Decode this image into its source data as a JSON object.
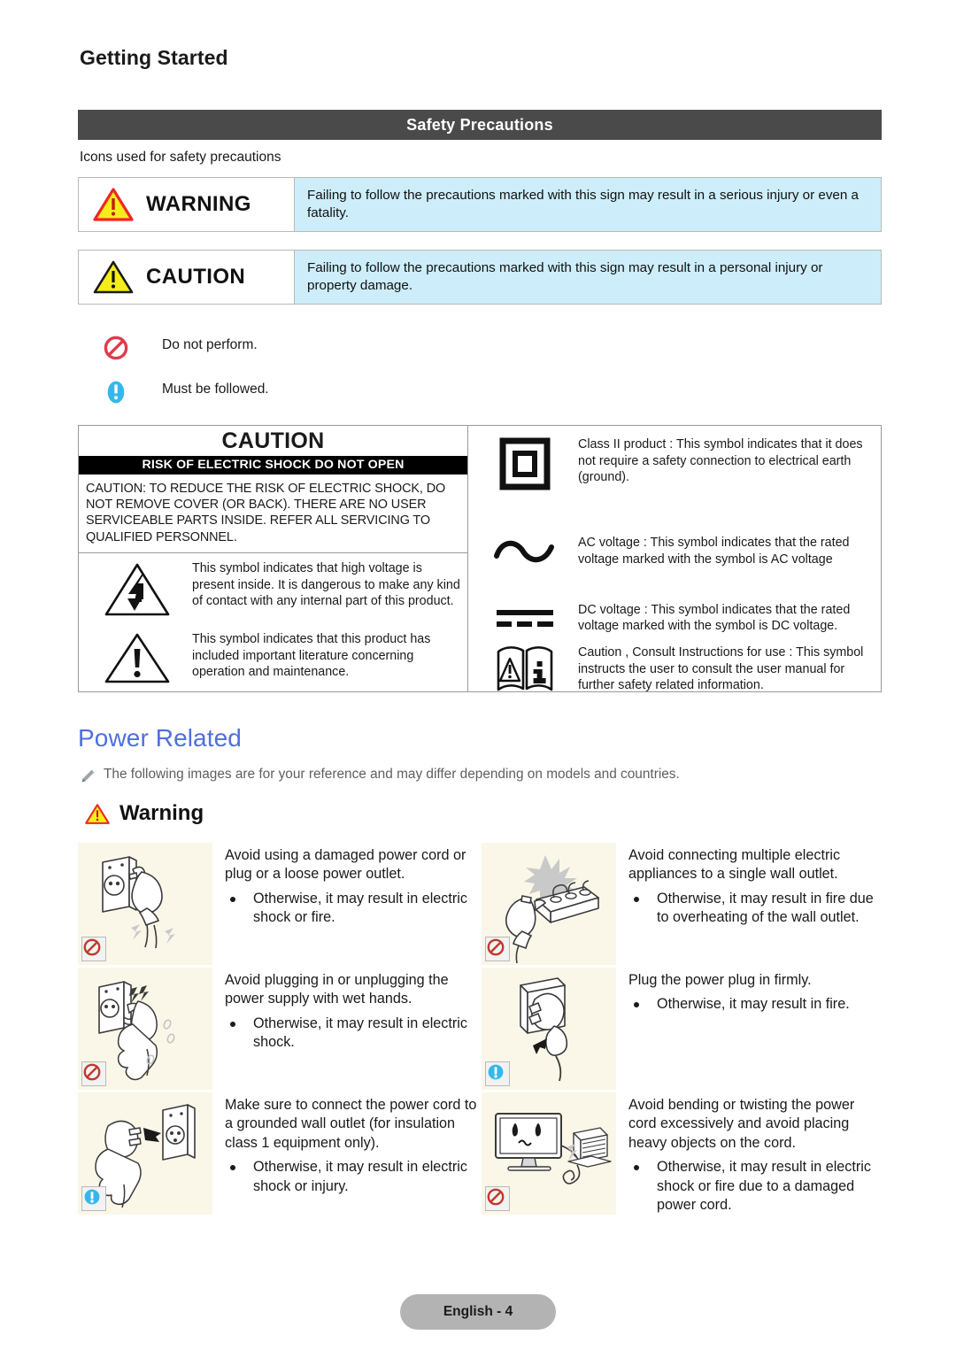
{
  "header": {
    "running_head": "Getting Started",
    "section_title": "Safety Precautions",
    "subhead": "Icons used for safety precautions"
  },
  "definitions": [
    {
      "icon": "warning-triangle-red-icon",
      "label": "WARNING",
      "text": "Failing to follow the precautions marked with this sign may result in a serious injury or even a fatality."
    },
    {
      "icon": "caution-triangle-black-icon",
      "label": "CAUTION",
      "text": "Failing to follow the precautions marked with this sign may result in a personal injury or property damage."
    }
  ],
  "legend": [
    {
      "icon": "prohibition-icon",
      "text": "Do not perform."
    },
    {
      "icon": "mandatory-icon",
      "text": "Must be followed."
    }
  ],
  "symbol_table": {
    "caution_title": "CAUTION",
    "caution_band": "RISK OF ELECTRIC SHOCK DO NOT OPEN",
    "caution_body": "CAUTION: TO REDUCE THE RISK OF ELECTRIC SHOCK, DO NOT REMOVE COVER (OR BACK). THERE ARE NO USER SERVICEABLE PARTS INSIDE. REFER ALL SERVICING TO QUALIFIED PERSONNEL.",
    "left_rows": [
      {
        "icon": "high-voltage-lightning-icon",
        "text": "This symbol indicates that high voltage is present inside. It is dangerous to make any kind of contact with any internal part of this product."
      },
      {
        "icon": "exclamation-triangle-icon",
        "text": "This symbol indicates that this product has included important literature concerning operation and maintenance."
      }
    ],
    "right_rows": [
      {
        "icon": "class-two-double-square-icon",
        "text": "Class II product : This symbol indicates that it does not require a safety connection to electrical earth (ground)."
      },
      {
        "icon": "ac-voltage-sine-icon",
        "text": "AC voltage : This symbol indicates that the rated voltage marked with the symbol is AC voltage"
      },
      {
        "icon": "dc-voltage-icon",
        "text": "DC voltage : This symbol indicates that the rated voltage marked with the symbol is DC voltage."
      },
      {
        "icon": "consult-manual-icon",
        "text": "Caution , Consult Instructions for use : This symbol instructs the user to consult the  user manual for further safety related information."
      }
    ]
  },
  "power_related": {
    "heading": "Power Related",
    "note_icon": "pencil-icon",
    "note": "The following images are for your reference and may differ depending on models and countries.",
    "warning_icon": "warning-triangle-red-icon",
    "warning_label": "Warning"
  },
  "safety_items": [
    {
      "illustration": "damaged-plug-and-outlet-illustration",
      "badge": "prohibition-icon",
      "lead": "Avoid using a damaged power cord or plug or a loose power outlet.",
      "bullets": [
        "Otherwise, it may result in electric shock or fire."
      ]
    },
    {
      "illustration": "overloaded-power-strip-illustration",
      "badge": "prohibition-icon",
      "lead": "Avoid connecting multiple electric appliances to a single wall outlet.",
      "bullets": [
        "Otherwise, it may result in fire due to overheating of the wall outlet."
      ]
    },
    {
      "illustration": "wet-hands-plug-illustration",
      "badge": "prohibition-icon",
      "lead": "Avoid plugging in or unplugging the power supply with wet hands.",
      "bullets": [
        "Otherwise, it may result in electric shock."
      ]
    },
    {
      "illustration": "plug-firmly-illustration",
      "badge": "mandatory-icon",
      "lead": "Plug the power plug in firmly.",
      "bullets": [
        "Otherwise, it may result in fire."
      ]
    },
    {
      "illustration": "grounded-outlet-illustration",
      "badge": "mandatory-icon",
      "lead": "Make sure to connect the power cord to a grounded wall outlet (for insulation class 1 equipment only).",
      "bullets": [
        "Otherwise, it may result in electric shock or injury."
      ]
    },
    {
      "illustration": "bent-cord-monitor-illustration",
      "badge": "prohibition-icon",
      "lead": "Avoid bending or twisting the power cord excessively and avoid placing heavy objects on the cord.",
      "bullets": [
        "Otherwise, it may result in electric shock or fire due to a damaged power cord."
      ]
    }
  ],
  "footer": {
    "page_label": "English - 4"
  },
  "colors": {
    "section_bar": "#4a4a4a",
    "desc_background": "#ccedf9",
    "heading_blue": "#4f6fdd",
    "illustration_background": "#faf7e8",
    "prohibition_red": "#e03a4e",
    "mandatory_blue": "#35b7ea",
    "warning_yellow": "#f5ec1b",
    "warning_red_border": "#ee2722",
    "footer_pill": "#b3b3b3"
  }
}
